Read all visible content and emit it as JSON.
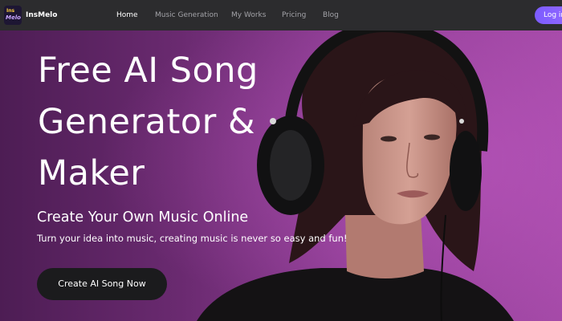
{
  "brand": {
    "name": "InsMelo",
    "logo_text_top": "Ins",
    "logo_text_bottom": "Melo"
  },
  "nav": {
    "items": [
      {
        "label": "Home",
        "active": true
      },
      {
        "label": "Music Generation",
        "active": false
      },
      {
        "label": "My Works",
        "active": false
      },
      {
        "label": "Pricing",
        "active": false
      },
      {
        "label": "Blog",
        "active": false
      }
    ],
    "login_label": "Log in"
  },
  "hero": {
    "title": "Free AI Song Generator & Maker",
    "subtitle": "Create Your Own Music Online",
    "description": "Turn your idea into music, creating music is never so easy and fun!",
    "cta_label": "Create AI Song Now",
    "image_subject": "woman-wearing-headphones"
  },
  "colors": {
    "topbar_bg": "#2c2c2e",
    "accent": "#7b5cff",
    "hero_bg_from": "#4d1d54",
    "hero_bg_to": "#a54aa8",
    "cta_bg": "#1b1b1d",
    "nav_inactive": "#a3a3a8"
  }
}
